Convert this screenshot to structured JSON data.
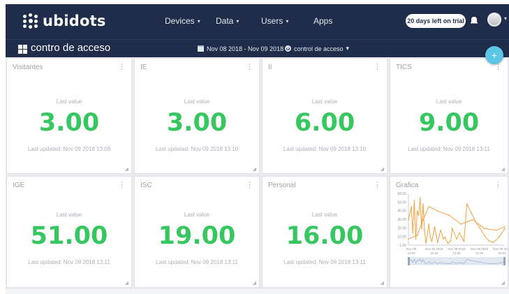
{
  "brand": {
    "name": "ubidots"
  },
  "nav": {
    "devices": "Devices",
    "data": "Data",
    "users": "Users",
    "apps": "Apps"
  },
  "trial": "20 days left on trial",
  "icons": {
    "bell": "bell-icon",
    "avatar": "user-avatar",
    "dashboards": "dashboard-grid-icon",
    "calendar": "calendar-icon",
    "settings": "gear-icon",
    "add": "plus-icon"
  },
  "dashboard": {
    "title": "contro de acceso",
    "date_range": "Nov 08 2018 - Nov 09 2018",
    "selector": "control de acceso"
  },
  "fab_label": "+",
  "colors": {
    "topbar": "#1f2c4a",
    "value_green": "#37c760",
    "graph_orange": "#f0a23c",
    "fab": "#5cc6e6"
  },
  "widgets": [
    {
      "title": "Visitantes",
      "subtitle": "Last value",
      "value": "3.00",
      "updated": "Last updated: Nov 09 2018 13:08"
    },
    {
      "title": "IE",
      "subtitle": "Last value",
      "value": "3.00",
      "updated": "Last updated: Nov 09 2018 13:10"
    },
    {
      "title": "II",
      "subtitle": "Last value",
      "value": "6.00",
      "updated": "Last updated: Nov 09 2018 13:10"
    },
    {
      "title": "TICS",
      "subtitle": "Last value",
      "value": "9.00",
      "updated": "Last updated: Nov 09 2018 13:11"
    },
    {
      "title": "IGE",
      "subtitle": "Last value",
      "value": "51.00",
      "updated": "Last updated: Nov 09 2018 13:11"
    },
    {
      "title": "ISC",
      "subtitle": "Last value",
      "value": "19.00",
      "updated": "Last updated: Nov 09 2018 13:11"
    },
    {
      "title": "Personal",
      "subtitle": "Last value",
      "value": "16.00",
      "updated": "Last updated: Nov 09 2018 13:11"
    }
  ],
  "graph_widget": {
    "title": "Grafica",
    "y_ticks": [
      "60.00",
      "50.00",
      "40.00",
      "30.00",
      "20.00",
      "10.00",
      "1.00"
    ],
    "x_ticks": [
      {
        "date": "Nov 09",
        "time": "12:00"
      },
      {
        "date": "Nov 09 2018",
        "time": "12:15"
      },
      {
        "date": "Nov 09 2018",
        "time": "12:30"
      },
      {
        "date": "Nov 09 2018",
        "time": "12:45"
      },
      {
        "date": "Nov 09 2018",
        "time": "13:00"
      }
    ]
  },
  "chart_data": {
    "type": "line",
    "title": "Grafica",
    "ylim": [
      1,
      60
    ],
    "series": [
      {
        "x": [
          0,
          2,
          3,
          4,
          5,
          6,
          7,
          8,
          9,
          10,
          11,
          12,
          14,
          15,
          16,
          18,
          19,
          20,
          22,
          24,
          25,
          27,
          29,
          30,
          33,
          35,
          38,
          40,
          43,
          46,
          49,
          52,
          55,
          58,
          62,
          66
        ],
        "values": [
          30,
          45,
          15,
          52,
          8,
          40,
          35,
          55,
          20,
          48,
          18,
          3,
          25,
          10,
          5,
          22,
          12,
          4,
          18,
          8,
          10,
          3,
          6,
          20,
          8,
          15,
          5,
          48,
          38,
          28,
          20,
          12,
          6,
          4,
          10,
          20
        ]
      },
      {
        "x": [
          0,
          6,
          10,
          14,
          20,
          28,
          36,
          44,
          52,
          60,
          66
        ],
        "values": [
          8,
          12,
          30,
          45,
          40,
          35,
          25,
          30,
          20,
          18,
          22
        ]
      }
    ],
    "grid": false
  }
}
